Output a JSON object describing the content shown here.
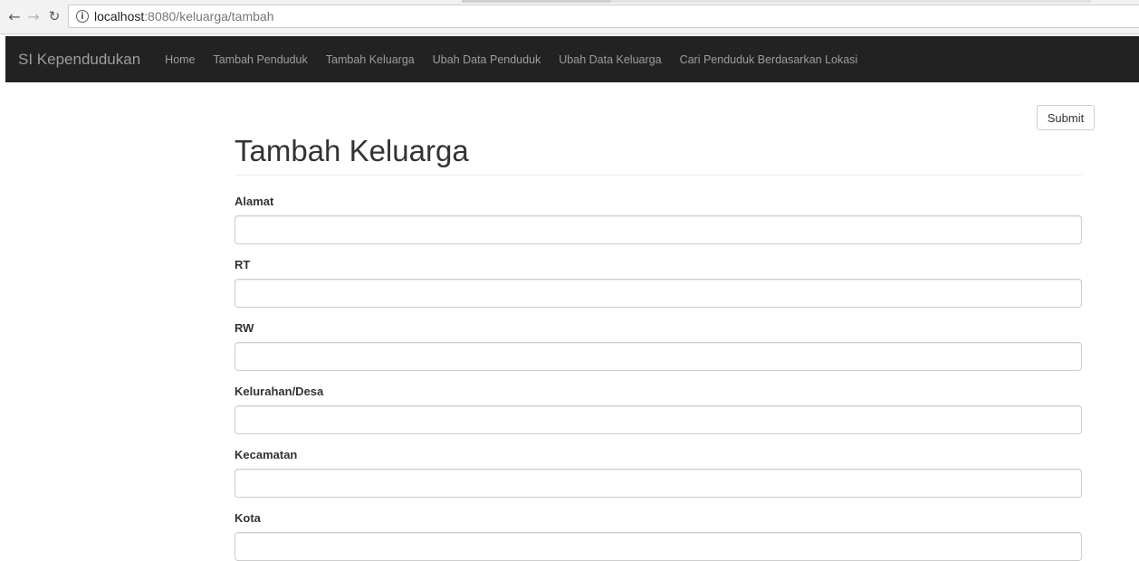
{
  "browser": {
    "url_host": "localhost",
    "url_path": ":8080/keluarga/tambah",
    "back_icon": "arrow-left-icon",
    "forward_icon": "arrow-right-icon",
    "reload_icon": "reload-icon",
    "info_icon": "info-icon"
  },
  "navbar": {
    "brand": "SI Kependudukan",
    "links": [
      "Home",
      "Tambah Penduduk",
      "Tambah Keluarga",
      "Ubah Data Penduduk",
      "Ubah Data Keluarga",
      "Cari Penduduk Berdasarkan Lokasi"
    ],
    "bg_color": "#222222",
    "text_color": "#9d9d9d"
  },
  "form": {
    "submit_label": "Submit",
    "title": "Tambah Keluarga",
    "fields": [
      {
        "label": "Alamat",
        "value": ""
      },
      {
        "label": "RT",
        "value": ""
      },
      {
        "label": "RW",
        "value": ""
      },
      {
        "label": "Kelurahan/Desa",
        "value": ""
      },
      {
        "label": "Kecamatan",
        "value": ""
      },
      {
        "label": "Kota",
        "value": ""
      }
    ]
  }
}
